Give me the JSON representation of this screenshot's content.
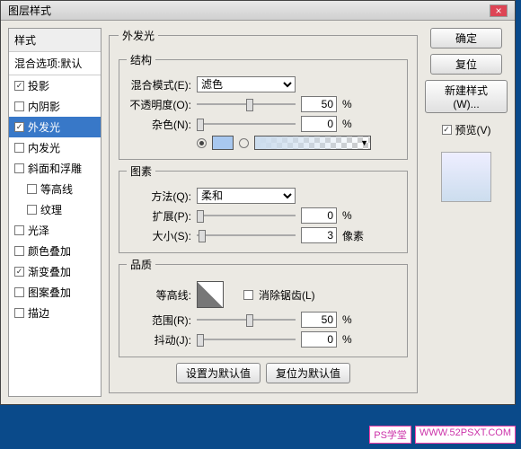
{
  "title": "图层样式",
  "sidebar": {
    "header": "样式",
    "sub": "混合选项:默认",
    "items": [
      {
        "label": "投影",
        "checked": true
      },
      {
        "label": "内阴影",
        "checked": false
      },
      {
        "label": "外发光",
        "checked": true,
        "selected": true
      },
      {
        "label": "内发光",
        "checked": false
      },
      {
        "label": "斜面和浮雕",
        "checked": false
      },
      {
        "label": "等高线",
        "checked": false,
        "indent": true
      },
      {
        "label": "纹理",
        "checked": false,
        "indent": true
      },
      {
        "label": "光泽",
        "checked": false
      },
      {
        "label": "颜色叠加",
        "checked": false
      },
      {
        "label": "渐变叠加",
        "checked": true
      },
      {
        "label": "图案叠加",
        "checked": false
      },
      {
        "label": "描边",
        "checked": false
      }
    ]
  },
  "panel": {
    "title": "外发光",
    "structure": {
      "legend": "结构",
      "blend_label": "混合模式(E):",
      "blend_value": "滤色",
      "opacity_label": "不透明度(O):",
      "opacity_value": "50",
      "opacity_unit": "%",
      "noise_label": "杂色(N):",
      "noise_value": "0",
      "noise_unit": "%",
      "color_swatch": "#a8c8ef"
    },
    "elements": {
      "legend": "图素",
      "method_label": "方法(Q):",
      "method_value": "柔和",
      "spread_label": "扩展(P):",
      "spread_value": "0",
      "spread_unit": "%",
      "size_label": "大小(S):",
      "size_value": "3",
      "size_unit": "像素"
    },
    "quality": {
      "legend": "品质",
      "contour_label": "等高线:",
      "anti_label": "消除锯齿(L)",
      "range_label": "范围(R):",
      "range_value": "50",
      "range_unit": "%",
      "jitter_label": "抖动(J):",
      "jitter_value": "0",
      "jitter_unit": "%"
    },
    "footer": {
      "set_default": "设置为默认值",
      "reset_default": "复位为默认值"
    }
  },
  "buttons": {
    "ok": "确定",
    "cancel": "复位",
    "new_style": "新建样式(W)...",
    "preview_label": "预览(V)"
  },
  "watermark": {
    "a": "PS学堂",
    "b": "WWW.52PSXT.COM"
  }
}
